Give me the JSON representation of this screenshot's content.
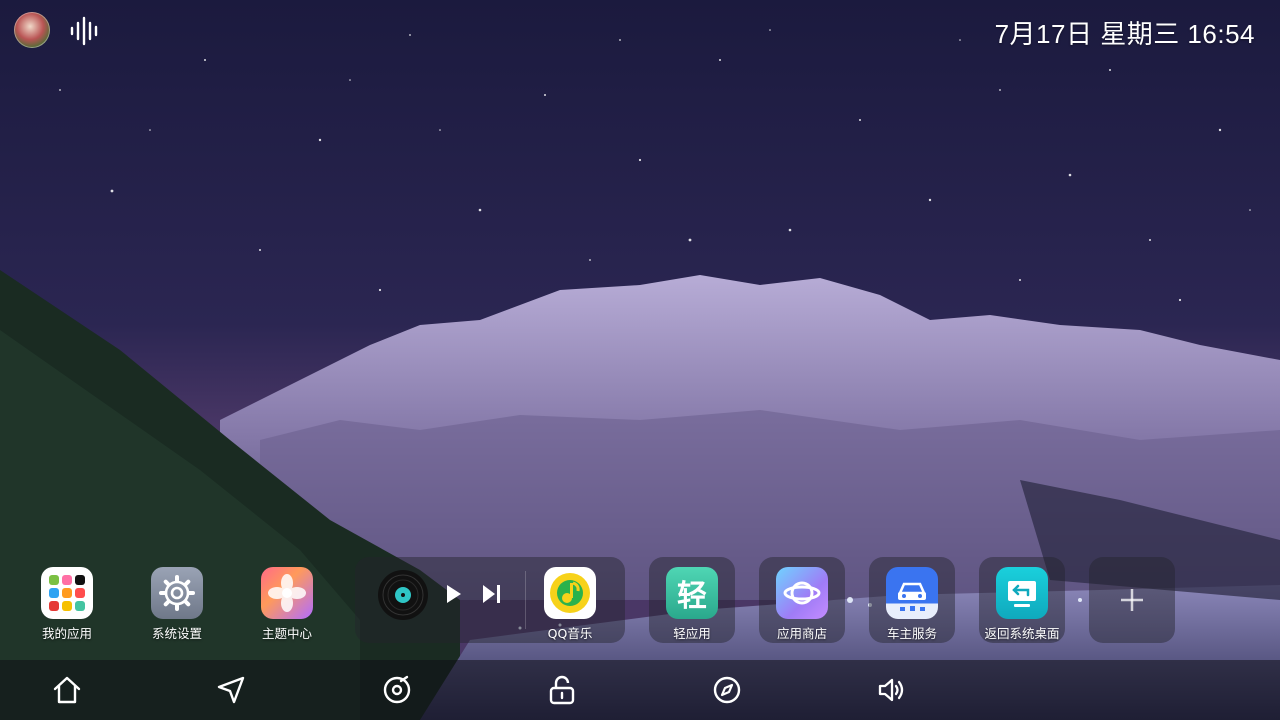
{
  "status_bar": {
    "avatar": "user-avatar",
    "voice_icon": "voice-assistant-icon",
    "datetime": "7月17日 星期三 16:54"
  },
  "dock": {
    "items": [
      {
        "label": "我的应用",
        "icon": "app-grid-icon"
      },
      {
        "label": "系统设置",
        "icon": "settings-gear-icon"
      },
      {
        "label": "主题中心",
        "icon": "theme-flower-icon"
      },
      {
        "label": "QQ音乐",
        "icon": "qq-music-icon"
      },
      {
        "label": "轻应用",
        "icon": "light-app-icon"
      },
      {
        "label": "应用商店",
        "icon": "app-store-icon"
      },
      {
        "label": "车主服务",
        "icon": "car-service-icon"
      },
      {
        "label": "返回系统桌面",
        "icon": "back-to-desktop-icon"
      }
    ],
    "add_icon": "add-icon",
    "light_app_glyph": "轻"
  },
  "music_widget": {
    "disc_icon": "vinyl-disc-icon",
    "play_icon": "play-icon",
    "next_icon": "next-track-icon"
  },
  "navbar": {
    "items": [
      "home-icon",
      "navigation-icon",
      "music-icon",
      "unlock-icon",
      "compass-icon",
      "volume-icon"
    ]
  },
  "colors": {
    "qq_music": "#f7d21a",
    "light_app": "#3fc7a6",
    "app_store": "#8b7cf6",
    "car_service": "#3a74f0",
    "desktop": "#17c6d6"
  }
}
